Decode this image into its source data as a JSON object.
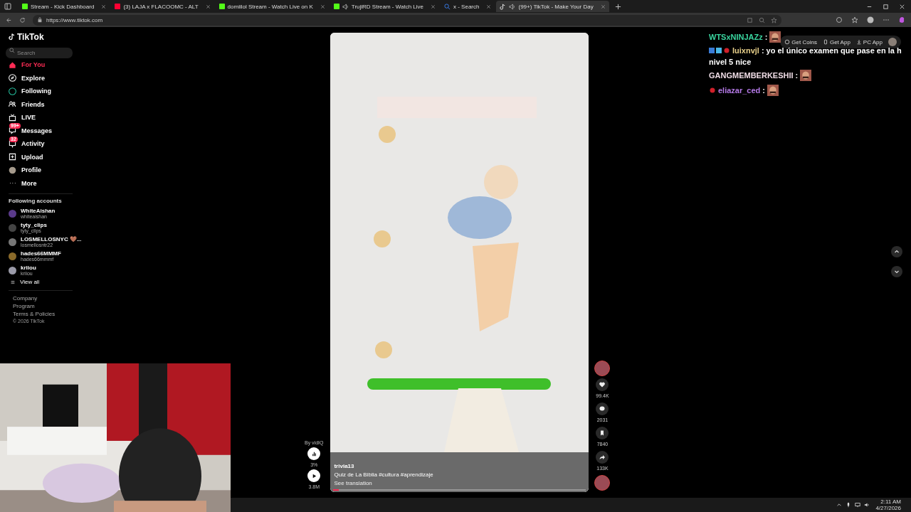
{
  "browser": {
    "tabs": [
      {
        "title": "Stream - Kick Dashboard",
        "audio": false,
        "selected": false
      },
      {
        "title": "(3) LAJA x FLACOOMC - ALT",
        "audio": false,
        "selected": false
      },
      {
        "title": "domiilol Stream - Watch Live on K",
        "audio": false,
        "selected": false
      },
      {
        "title": "TrujiRD Stream - Watch Live",
        "audio": true,
        "selected": false
      },
      {
        "title": "x - Search",
        "audio": false,
        "selected": false
      },
      {
        "title": "(99+) TikTok - Make Your Day",
        "audio": true,
        "selected": true
      }
    ],
    "url": "https://www.tiktok.com"
  },
  "sidebar": {
    "logo": "TikTok",
    "search": {
      "placeholder": "Search"
    },
    "nav": [
      {
        "label": "For You",
        "selected": true
      },
      {
        "label": "Explore",
        "selected": false
      },
      {
        "label": "Following",
        "selected": false
      },
      {
        "label": "Friends",
        "selected": false
      },
      {
        "label": "LIVE",
        "selected": false
      },
      {
        "label": "Messages",
        "badge": "99+",
        "selected": false
      },
      {
        "label": "Activity",
        "badge": "32",
        "selected": false
      },
      {
        "label": "Upload",
        "selected": false
      },
      {
        "label": "Profile",
        "selected": false
      },
      {
        "label": "More",
        "selected": false
      }
    ],
    "following_heading": "Following accounts",
    "accounts": [
      {
        "name": "WhiteAishan",
        "handle": "whiteaishan",
        "color": "#5a3a8a"
      },
      {
        "name": "tyty_clips",
        "handle": "tyty_clips",
        "color": "#444444"
      },
      {
        "name": "LOSMELLOSNYC 🤎...",
        "handle": "losmellosntr22",
        "color": "#777777"
      },
      {
        "name": "hades66MMMF",
        "handle": "hades66mmmf",
        "color": "#8a6a2a"
      },
      {
        "name": "kriiou",
        "handle": "kriiou",
        "color": "#9a9aa8"
      }
    ],
    "view_all": "View all",
    "footer": [
      "Company",
      "Program",
      "Terms & Policies"
    ],
    "copyright": "© 2026 TikTok"
  },
  "header_buttons": [
    "Get Coins",
    "Get App",
    "PC App"
  ],
  "video": {
    "kind": "picture",
    "author": "trivia13",
    "caption": "Quiz de La Biblia",
    "hashtags": "#cultura #aprendizaje",
    "translate": "See translation",
    "progress": {
      "level": 0.02
    }
  },
  "vidiq": {
    "label": "By vidIQ",
    "percent": "3%",
    "views": "3.8M"
  },
  "actions": [
    {
      "count": "99.4K"
    },
    {
      "count": "2031"
    },
    {
      "count": "7840"
    },
    {
      "count": "133K"
    }
  ],
  "chat": [
    {
      "user": "WTSxNINJAZz",
      "sep": ":",
      "color": "#3ad6a0",
      "emote": true,
      "badges": false
    },
    {
      "user": "luixnvjl",
      "sep": ":",
      "color": "#e8d08a",
      "lines": [
        "yo el único examen que pase en la h",
        "nivel 5 nice"
      ],
      "emote": false,
      "badges": true
    },
    {
      "user": "GANGMEMBERKESHII",
      "sep": ":",
      "color": "#f0dde6",
      "emote": true,
      "badges": false
    },
    {
      "user": "eliazar_ced",
      "sep": ":",
      "color": "#b57ae8",
      "emote": true,
      "badges": true
    }
  ],
  "taskbar": {
    "time": "2:11 AM",
    "date": "4/27/2026"
  }
}
